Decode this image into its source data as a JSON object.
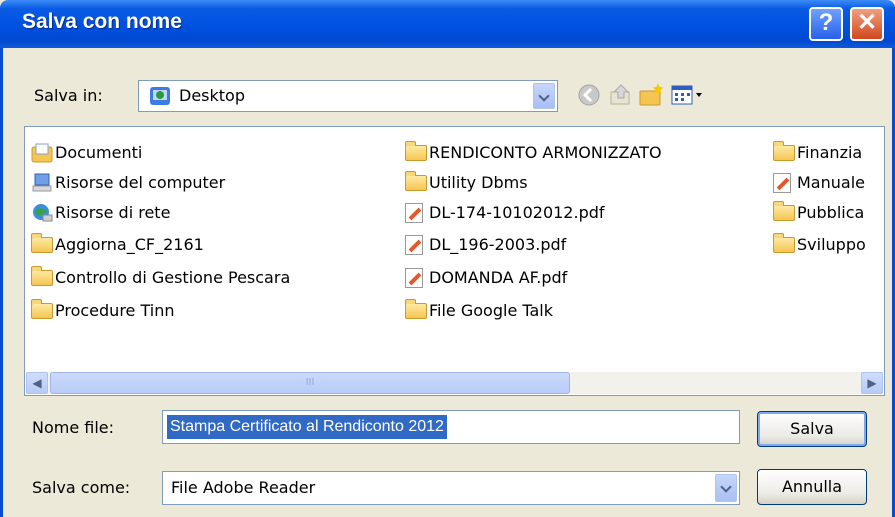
{
  "window": {
    "title": "Salva con nome",
    "help_label": "?",
    "close_label": "✕"
  },
  "location": {
    "label": "Salva in:",
    "value": "Desktop",
    "icon": "desktop-icon"
  },
  "toolbar": {
    "back_icon": "back-icon",
    "up_icon": "up-folder-icon",
    "new_folder_icon": "new-folder-icon",
    "views_icon": "views-menu-icon"
  },
  "files": [
    {
      "name": "Documenti",
      "icon": "my-documents-icon"
    },
    {
      "name": "Risorse del computer",
      "icon": "my-computer-icon"
    },
    {
      "name": "Risorse di rete",
      "icon": "network-icon"
    },
    {
      "name": "Aggiorna_CF_2161",
      "icon": "folder-icon"
    },
    {
      "name": "Controllo di Gestione Pescara",
      "icon": "folder-icon"
    },
    {
      "name": "Procedure Tinn",
      "icon": "folder-icon"
    },
    {
      "name": "RENDICONTO ARMONIZZATO",
      "icon": "folder-icon"
    },
    {
      "name": "Utility Dbms",
      "icon": "folder-icon"
    },
    {
      "name": "DL-174-10102012.pdf",
      "icon": "pdf-icon"
    },
    {
      "name": "DL_196-2003.pdf",
      "icon": "pdf-icon"
    },
    {
      "name": "DOMANDA AF.pdf",
      "icon": "pdf-icon"
    },
    {
      "name": "File Google Talk",
      "icon": "folder-shortcut-icon"
    },
    {
      "name": "Finanzia",
      "icon": "folder-shortcut-icon"
    },
    {
      "name": "Manuale",
      "icon": "pdf-icon"
    },
    {
      "name": "Pubblica",
      "icon": "folder-shortcut-icon"
    },
    {
      "name": "Sviluppo",
      "icon": "folder-shortcut-icon"
    }
  ],
  "scrollbar": {
    "grip": "III"
  },
  "filename": {
    "label": "Nome file:",
    "value": "Stampa Certificato al Rendiconto 2012"
  },
  "filetype": {
    "label": "Salva come:",
    "value": "File Adobe Reader"
  },
  "buttons": {
    "save": "Salva",
    "cancel": "Annulla"
  }
}
